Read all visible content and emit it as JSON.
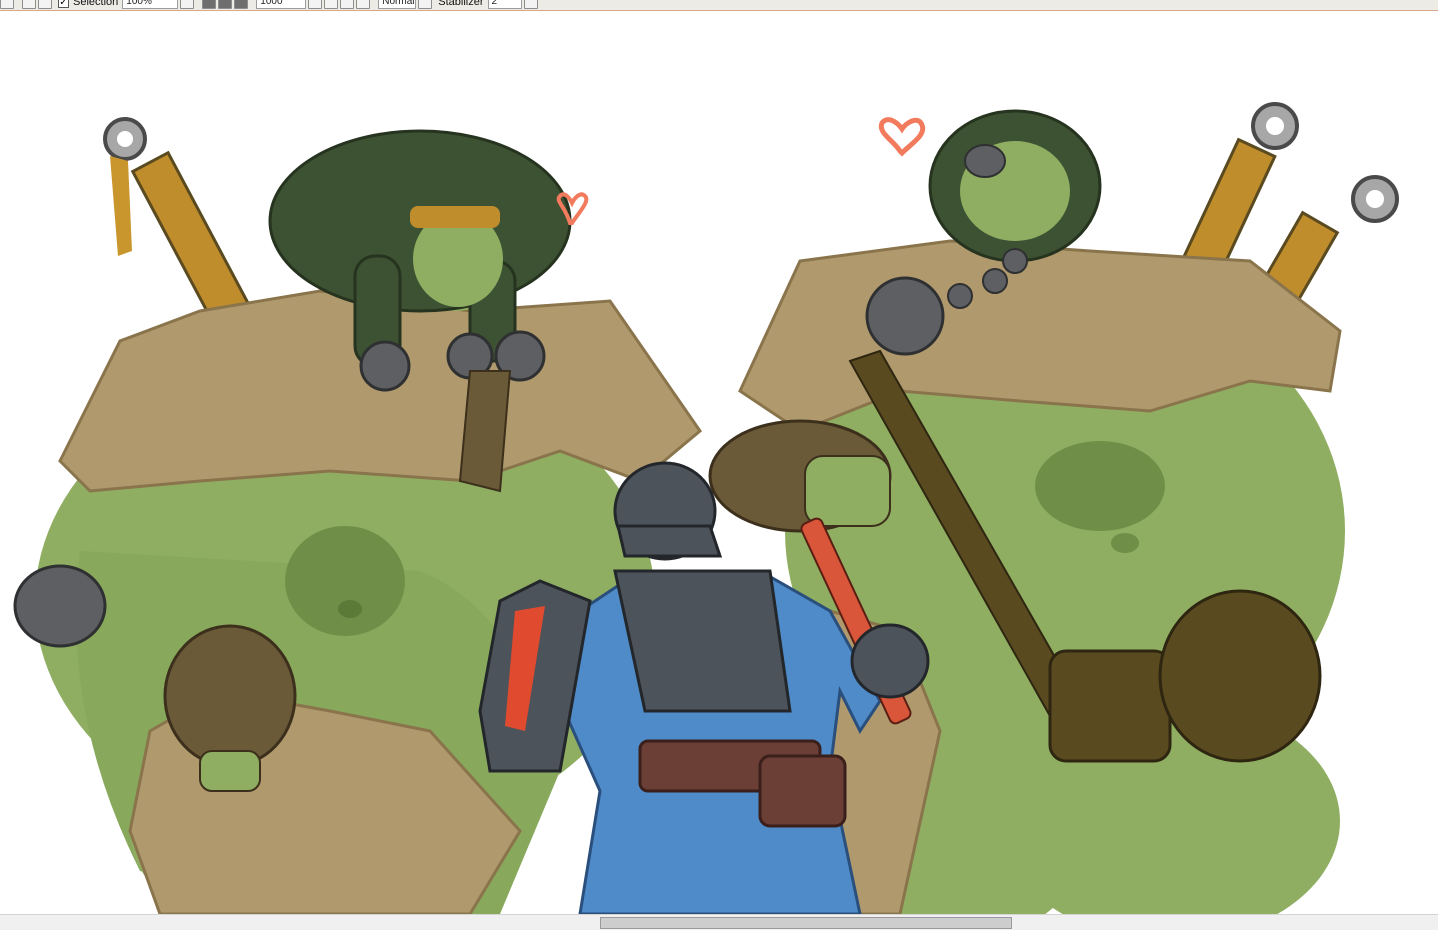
{
  "toolbar": {
    "selection_label": "Selection",
    "selection_checked": true,
    "zoom_value": "100%",
    "size_value": "1000",
    "blend_mode": "Normal",
    "stabilizer_label": "Stabilizer",
    "stabilizer_value": "2"
  },
  "canvas": {
    "artwork_description_icons": [
      "heart-icon",
      "heart-icon"
    ],
    "colors": {
      "skin": "#8fae62",
      "skin_dark": "#6f8f48",
      "hair": "#3d5232",
      "fur": "#b09a6d",
      "fur_dark": "#8a744c",
      "metal": "#5d5f62",
      "knight_blue": "#4f8bc9",
      "knight_armor": "#4d535a",
      "leather": "#6b3e36",
      "sword_wrap": "#c08d2c",
      "heart": "#f27b5e",
      "toolbar_border": "#d9a88a"
    }
  },
  "scrollbar": {
    "orientation": "horizontal"
  }
}
